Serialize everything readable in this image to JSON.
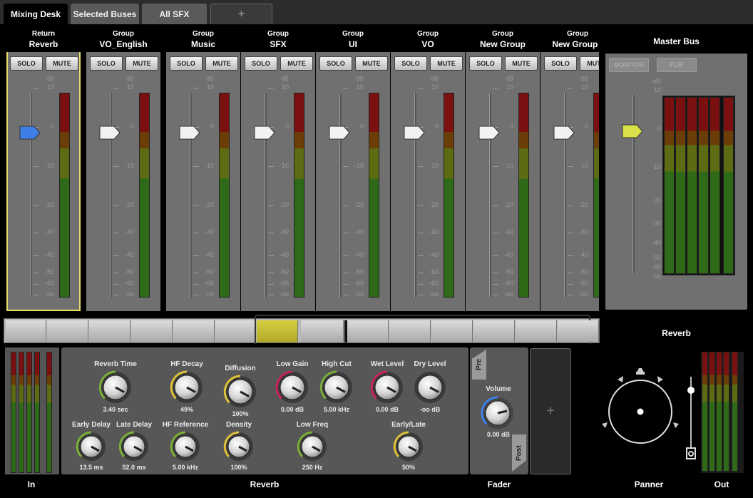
{
  "tabs": [
    {
      "label": "Mixing Desk",
      "active": true
    },
    {
      "label": "Selected Buses",
      "active": false
    },
    {
      "label": "All SFX",
      "active": false
    },
    {
      "label": "+",
      "active": false
    }
  ],
  "strips": [
    {
      "kind": "Return",
      "name": "Reverb",
      "selected": true,
      "fader_color": "#3d7fe6"
    },
    {
      "kind": "Group",
      "name": "VO_English",
      "selected": false,
      "fader_color": "#f2f2f2"
    },
    {
      "kind": "Group",
      "name": "Music",
      "selected": false,
      "fader_color": "#f2f2f2"
    },
    {
      "kind": "Group",
      "name": "SFX",
      "selected": false,
      "fader_color": "#f2f2f2"
    },
    {
      "kind": "Group",
      "name": "UI",
      "selected": false,
      "fader_color": "#f2f2f2"
    },
    {
      "kind": "Group",
      "name": "VO",
      "selected": false,
      "fader_color": "#f2f2f2"
    },
    {
      "kind": "Group",
      "name": "New Group",
      "selected": false,
      "fader_color": "#f2f2f2"
    },
    {
      "kind": "Group",
      "name": "New Group (",
      "selected": false,
      "fader_color": "#f2f2f2"
    }
  ],
  "strip_buttons": {
    "solo": "SOLO",
    "mute": "MUTE"
  },
  "db_unit": "dB",
  "db_scale": [
    "10",
    "0",
    "-10",
    "-20",
    "-30",
    "-40",
    "-50",
    "-60",
    "-oo"
  ],
  "master": {
    "title": "Master Bus",
    "monitor": "MONITOR",
    "flip": "FLIP",
    "fader_color": "#d8e04a",
    "db_scale": [
      "10",
      "0",
      "-10",
      "-20",
      "-30",
      "-40",
      "-50",
      "-60",
      "-oo"
    ]
  },
  "reverb_panel_title": "Reverb",
  "effect": {
    "params": [
      {
        "label": "Reverb Time",
        "value": "3.40 sec",
        "ring": "#7ab03a"
      },
      {
        "label": "HF Decay",
        "value": "49%",
        "ring": "#e0c23a"
      },
      {
        "label": "Diffusion",
        "value": "100%",
        "ring": "#e0c23a"
      },
      {
        "label": "Low Gain",
        "value": "0.00 dB",
        "ring": "#c8245a"
      },
      {
        "label": "High Cut",
        "value": "5.00 kHz",
        "ring": "#7ab03a"
      },
      {
        "label": "Wet Level",
        "value": "0.00 dB",
        "ring": "#c8245a"
      },
      {
        "label": "Dry Level",
        "value": "-oo dB",
        "ring": "none"
      },
      {
        "label": "Early Delay",
        "value": "13.5 ms",
        "ring": "#7ab03a"
      },
      {
        "label": "Late Delay",
        "value": "52.0 ms",
        "ring": "#7ab03a"
      },
      {
        "label": "HF Reference",
        "value": "5.00 kHz",
        "ring": "#7ab03a"
      },
      {
        "label": "Density",
        "value": "100%",
        "ring": "#e0c23a"
      },
      {
        "label": "Low Freq",
        "value": "250 Hz",
        "ring": "#7ab03a"
      },
      {
        "label": "Early/Late",
        "value": "50%",
        "ring": "#e0c23a"
      }
    ]
  },
  "fader_panel": {
    "volume_label": "Volume",
    "volume_value": "0.00 dB",
    "pre": "Pre",
    "post": "Post",
    "add": "+"
  },
  "section_labels": {
    "in": "In",
    "reverb": "Reverb",
    "fader": "Fader",
    "panner": "Panner",
    "out": "Out"
  }
}
